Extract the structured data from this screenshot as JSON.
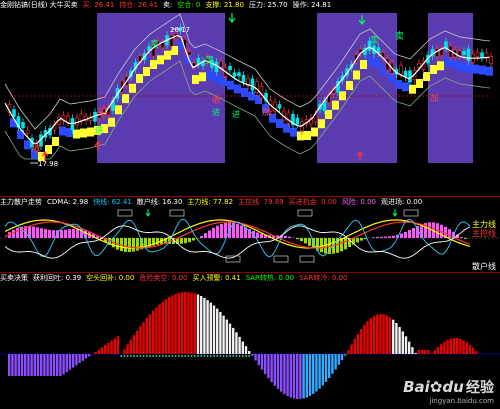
{
  "top": {
    "items": [
      {
        "text": "金刚钻镐(日线) 大牛买卖",
        "color": "#ffffff"
      },
      {
        "text": "买: 26.41",
        "color": "#ff3333"
      },
      {
        "text": "持仓: 26.41",
        "color": "#ff3333"
      },
      {
        "text": "卖: ",
        "color": "#ffffff"
      },
      {
        "text": "空仓: 0",
        "color": "#00ff00"
      },
      {
        "text": "支撑: 21.80",
        "color": "#ffff00"
      },
      {
        "text": "压力: 25.70",
        "color": "#ffffff"
      },
      {
        "text": "操作: 24.81",
        "color": "#ffffff"
      }
    ],
    "price_high": "20.17",
    "price_low": "17.98",
    "signals": {
      "buy": "买",
      "sell": "卖",
      "enter": "进",
      "add": "加",
      "recover": "收",
      "retreat": "退"
    }
  },
  "mid": {
    "items": [
      {
        "text": "主力散户走势",
        "color": "#ffffff"
      },
      {
        "text": "CDMA: 2.98",
        "color": "#ffffff"
      },
      {
        "text": "快线: 62.41",
        "color": "#00ccff"
      },
      {
        "text": "散户线: 16.30",
        "color": "#ffffff"
      },
      {
        "text": "主力线: 77.82",
        "color": "#ffff00"
      },
      {
        "text": "主控线: 79.89",
        "color": "#ff3333"
      },
      {
        "text": "买进机会: 0.00",
        "color": "#ff3333"
      },
      {
        "text": "风险: 0.00",
        "color": "#ff66ff"
      },
      {
        "text": "观进场: 0.00",
        "color": "#ffffff"
      }
    ],
    "labels": {
      "main": "主力线",
      "control": "主控线",
      "retail": "散户线"
    }
  },
  "bot": {
    "items": [
      {
        "text": "买卖决策",
        "color": "#ffffff"
      },
      {
        "text": "获利回吐: 0.39",
        "color": "#ffffff"
      },
      {
        "text": "空头回补: 0.00",
        "color": "#ffff00"
      },
      {
        "text": "危险卖空: 0.00",
        "color": "#ff3333"
      },
      {
        "text": "买入预警: 0.41",
        "color": "#ffff00"
      },
      {
        "text": "SAR转热: 0.00",
        "color": "#00ff00"
      },
      {
        "text": "SAR转冷: 0.00",
        "color": "#ff3333"
      }
    ]
  },
  "watermark": {
    "logo": "Bai",
    "logo2": "du",
    "cn": "经验",
    "sub": "jingyan.baidu.com"
  }
}
